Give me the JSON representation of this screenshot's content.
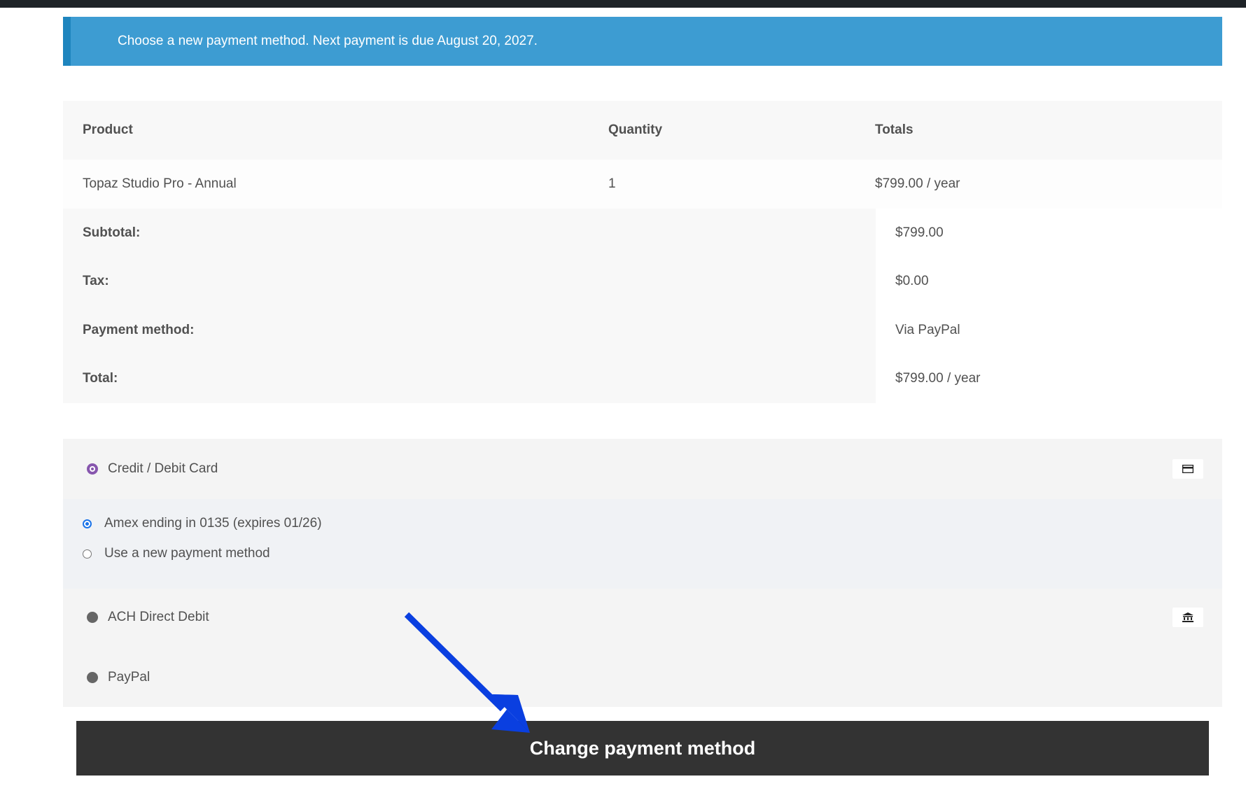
{
  "notice": {
    "text": "Choose a new payment method. Next payment is due August 20, 2027."
  },
  "order_table": {
    "headers": {
      "product": "Product",
      "quantity": "Quantity",
      "totals": "Totals"
    },
    "item": {
      "product": "Topaz Studio Pro - Annual",
      "quantity": "1",
      "total": "$799.00 / year"
    },
    "summary": [
      {
        "label": "Subtotal:",
        "value": "$799.00"
      },
      {
        "label": "Tax:",
        "value": "$0.00"
      },
      {
        "label": "Payment method:",
        "value": "Via PayPal"
      },
      {
        "label": "Total:",
        "value": "$799.00 / year"
      }
    ]
  },
  "payment_methods": {
    "card": {
      "label": "Credit / Debit Card",
      "icon": "credit-card-icon",
      "selected": true
    },
    "saved_options": [
      {
        "label": "Amex ending in 0135 (expires 01/26)",
        "selected": true
      },
      {
        "label": "Use a new payment method",
        "selected": false
      }
    ],
    "ach": {
      "label": "ACH Direct Debit",
      "icon": "bank-icon",
      "selected": false
    },
    "paypal": {
      "label": "PayPal",
      "selected": false
    }
  },
  "submit": {
    "label": "Change payment method"
  },
  "colors": {
    "notice_bg": "#3d9cd2",
    "button_bg": "#333333",
    "arrow": "#0a3fe0",
    "selected_radio": "#8756ae"
  }
}
